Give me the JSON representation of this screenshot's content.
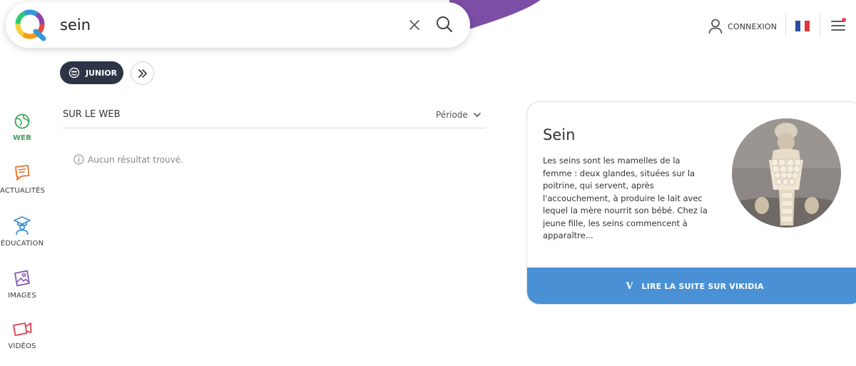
{
  "search": {
    "query": "sein"
  },
  "header": {
    "login_label": "CONNEXION",
    "language": "fr"
  },
  "filters": {
    "junior_label": "JUNIOR"
  },
  "sidebar": {
    "items": [
      {
        "label": "WEB",
        "icon": "globe-icon",
        "active": true
      },
      {
        "label": "ACTUALITÉS",
        "icon": "news-icon",
        "active": false
      },
      {
        "label": "ÉDUCATION",
        "icon": "education-icon",
        "active": false
      },
      {
        "label": "IMAGES",
        "icon": "images-icon",
        "active": false
      },
      {
        "label": "VIDÉOS",
        "icon": "videos-icon",
        "active": false
      }
    ]
  },
  "results": {
    "section_title": "SUR LE WEB",
    "period_label": "Période",
    "no_result": "Aucun résultat trouvé."
  },
  "card": {
    "title": "Sein",
    "text": "Les seins sont les mamelles de la femme : deux glandes, situées sur la poitrine, qui servent, après l'accouchement, à produire le lait avec lequel la mère nourrit son bébé. Chez la jeune fille, les seins commencent à apparaître...",
    "footer_letter": "V",
    "footer_label": "LIRE LA SUITE SUR VIKIDIA"
  },
  "colors": {
    "accent_green": "#3aa655",
    "navy": "#2d3446",
    "vikidia_blue": "#4a90d4",
    "rainbow": [
      "#e84c3d",
      "#f39c12",
      "#f4d03f",
      "#2ecc71",
      "#3498db",
      "#8e44ad"
    ]
  }
}
